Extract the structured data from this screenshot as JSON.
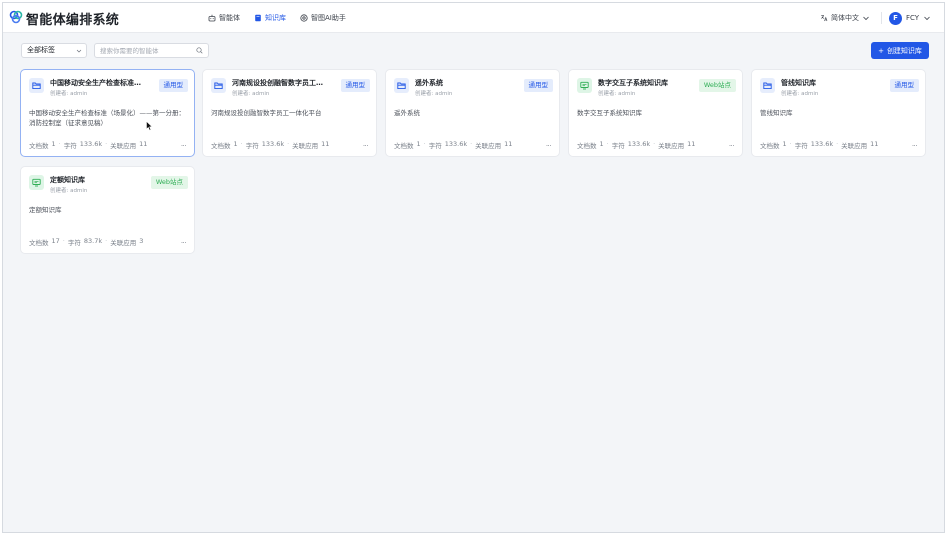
{
  "app": {
    "title": "智能体编排系统"
  },
  "nav": [
    {
      "label": "智能体",
      "icon": "robot-icon"
    },
    {
      "label": "知识库",
      "icon": "book-icon",
      "active": true
    },
    {
      "label": "智图AI助手",
      "icon": "bot-icon"
    }
  ],
  "header": {
    "language": "简体中文",
    "user_initial": "F",
    "user_name": "FCY"
  },
  "toolbar": {
    "tag_filter": "全部标签",
    "search_placeholder": "搜索你需要的智能体",
    "create_label": "创建知识库"
  },
  "footer_labels": {
    "docs": "文档数",
    "chars": "字符",
    "apps": "关联应用"
  },
  "cards": [
    {
      "name": "中国移动安全生产检查标准（场景化）...",
      "creator": "创建者: admin",
      "tag": "通用型",
      "tag_type": "general",
      "desc": "中国移动安全生产检查标准（场景化）——第一分册：消防控制室（征求意见稿）",
      "docs": "1",
      "chars": "133.6k",
      "apps": "11",
      "icon": "folder"
    },
    {
      "name": "河南规设投创融智数字员工一体化平台",
      "creator": "创建者: admin",
      "tag": "通用型",
      "tag_type": "general",
      "desc": "河南规设投创融智数字员工一体化平台",
      "docs": "1",
      "chars": "133.6k",
      "apps": "11",
      "icon": "folder"
    },
    {
      "name": "遥外系统",
      "creator": "创建者: admin",
      "tag": "通用型",
      "tag_type": "general",
      "desc": "遥外系统",
      "docs": "1",
      "chars": "133.6k",
      "apps": "11",
      "icon": "folder"
    },
    {
      "name": "数字交互子系统知识库",
      "creator": "创建者: admin",
      "tag": "Web站点",
      "tag_type": "web",
      "desc": "数字交互子系统知识库",
      "docs": "1",
      "chars": "133.6k",
      "apps": "11",
      "icon": "web"
    },
    {
      "name": "管线知识库",
      "creator": "创建者: admin",
      "tag": "通用型",
      "tag_type": "general",
      "desc": "管线知识库",
      "docs": "1",
      "chars": "133.6k",
      "apps": "11",
      "icon": "folder"
    },
    {
      "name": "定额知识库",
      "creator": "创建者: admin",
      "tag": "Web站点",
      "tag_type": "web",
      "desc": "定额知识库",
      "docs": "17",
      "chars": "83.7k",
      "apps": "3",
      "icon": "web"
    }
  ],
  "colors": {
    "accent": "#2257e6",
    "web_green": "#2fae55"
  }
}
